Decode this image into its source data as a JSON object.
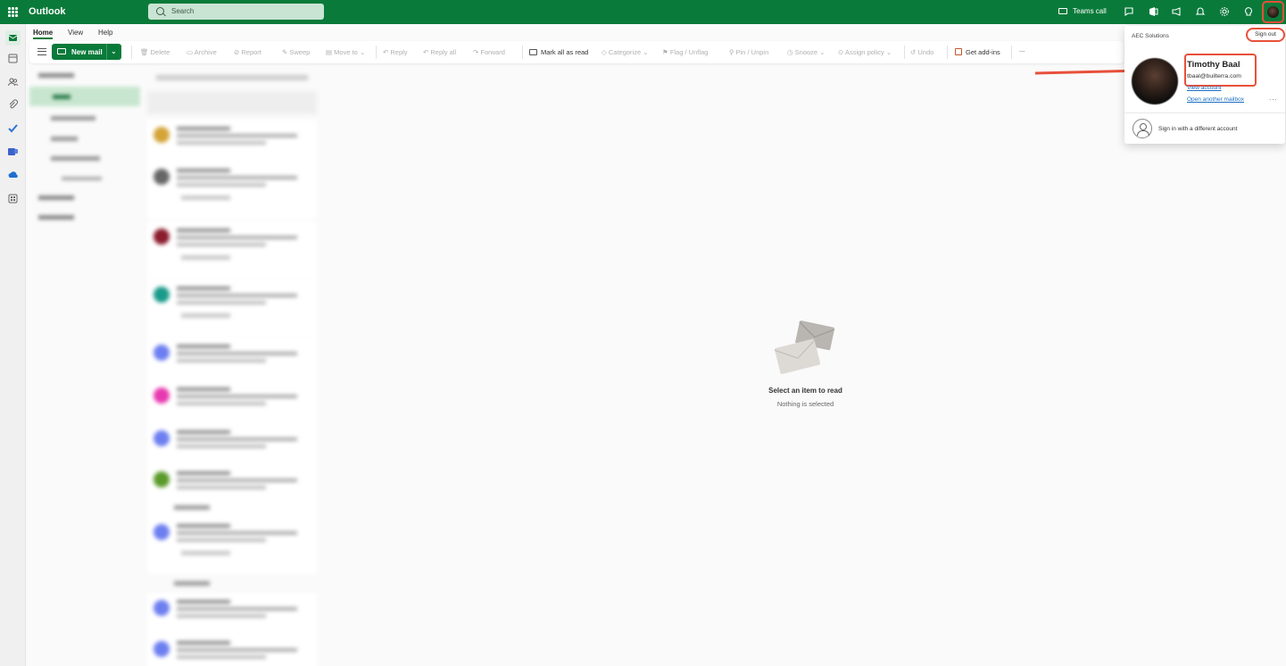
{
  "app": {
    "name": "Outlook"
  },
  "search": {
    "placeholder": "Search"
  },
  "topbar": {
    "teams_call_label": "Teams call",
    "icons": [
      "video-camera-icon",
      "chat-icon",
      "office-icon",
      "megaphone-icon",
      "bell-icon",
      "gear-icon",
      "lightbulb-icon"
    ]
  },
  "tabs": [
    "Home",
    "View",
    "Help"
  ],
  "ribbon": {
    "new_mail": "New mail",
    "delete": "Delete",
    "archive": "Archive",
    "report": "Report",
    "sweep": "Sweep",
    "move_to": "Move to",
    "reply": "Reply",
    "reply_all": "Reply all",
    "forward": "Forward",
    "mark_all_read": "Mark all as read",
    "categorize": "Categorize",
    "flag_unflag": "Flag / Unflag",
    "pin_unpin": "Pin / Unpin",
    "snooze": "Snooze",
    "assign_policy": "Assign policy",
    "undo": "Undo",
    "get_addins": "Get add-ins",
    "more": "..."
  },
  "reading_pane": {
    "title": "Select an item to read",
    "subtitle": "Nothing is selected"
  },
  "account_card": {
    "org": "AEC Solutions",
    "sign_out": "Sign out",
    "name": "Timothy Baal",
    "email": "tbaal@builterra.com",
    "view_account": "View account",
    "open_mailbox": "Open another mailbox",
    "more": "...",
    "sign_in_different": "Sign in with a different account"
  },
  "colors": {
    "brand": "#0a7a3a",
    "annotation": "#e8503a",
    "link": "#1a6fc4"
  }
}
